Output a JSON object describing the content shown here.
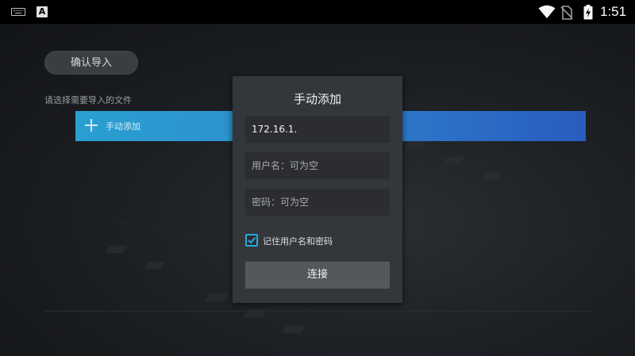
{
  "statusbar": {
    "a_badge": "A",
    "time": "1:51",
    "icons": [
      "keyboard-icon",
      "a-icon",
      "wifi-icon",
      "no-sim-icon",
      "battery-charging-icon"
    ]
  },
  "page": {
    "confirm_button": "确认导入",
    "choose_label": "请选择需要导入的文件",
    "add_bar_label": "手动添加"
  },
  "dialog": {
    "title": "手动添加",
    "ip_value": "172.16.1.",
    "username_placeholder": "用户名：可为空",
    "password_placeholder": "密码：可为空",
    "remember_label": "记住用户名和密码",
    "remember_checked": true,
    "connect_button": "连接"
  },
  "colors": {
    "accent": "#27a9e1",
    "bar_start": "#2a9fd0",
    "bar_end": "#2a5cbf",
    "dialog_bg": "#33363b"
  }
}
